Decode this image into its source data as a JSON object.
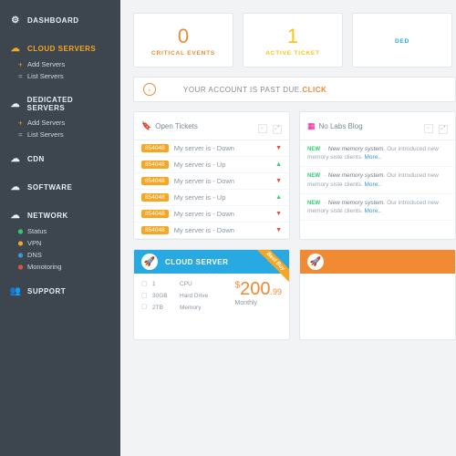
{
  "sidebar": {
    "items": [
      {
        "label": "DASHBOARD",
        "icon": "⚙"
      },
      {
        "label": "CLOUD SERVERS",
        "icon": "☁",
        "active": true,
        "subs": [
          {
            "label": "Add Servers",
            "type": "plus"
          },
          {
            "label": "List Servers",
            "type": "dash"
          }
        ]
      },
      {
        "label": "DEDICATED SERVERS",
        "icon": "☁",
        "subs": [
          {
            "label": "Add Servers",
            "type": "plus"
          },
          {
            "label": "List Servers",
            "type": "dash"
          }
        ]
      },
      {
        "label": "CDN",
        "icon": "☁"
      },
      {
        "label": "SOFTWARE",
        "icon": "☁"
      },
      {
        "label": "NETWORK",
        "icon": "☁",
        "subs": [
          {
            "label": "Status",
            "type": "dot",
            "color": "#2ecc71"
          },
          {
            "label": "VPN",
            "type": "dot",
            "color": "#f5a623"
          },
          {
            "label": "DNS",
            "type": "dot",
            "color": "#3498db"
          },
          {
            "label": "Monotoring",
            "type": "dot",
            "color": "#e74c3c"
          }
        ]
      },
      {
        "label": "SUPPORT",
        "icon": "👥"
      }
    ]
  },
  "stats": [
    {
      "value": "0",
      "label": "CRITICAL EVENTS",
      "color": "#f08a33"
    },
    {
      "value": "1",
      "label": "ACTIVE TICKET",
      "color": "#f5c518"
    },
    {
      "value": "",
      "label": "DED",
      "color": "#29a9e1"
    }
  ],
  "alert": {
    "text": "YOUR ACCOUNT IS PAST DUE. ",
    "action": "CLICK",
    "arrow": "›"
  },
  "tickets": {
    "title": "Open Tickets",
    "rows": [
      {
        "id": "854048",
        "text": "My server is - Down",
        "dir": "down"
      },
      {
        "id": "854048",
        "text": "My server is - Up",
        "dir": "up"
      },
      {
        "id": "854048",
        "text": "My server is - Down",
        "dir": "down"
      },
      {
        "id": "854048",
        "text": "My server is - Up",
        "dir": "up"
      },
      {
        "id": "854048",
        "text": "My server is - Down",
        "dir": "down"
      },
      {
        "id": "854048",
        "text": "My server is - Down",
        "dir": "down"
      }
    ]
  },
  "blog": {
    "title": "No Labs Blog",
    "rows": [
      {
        "tag": "NEW",
        "title": "New memory system.",
        "body": "Our introduced new memory siste clients.",
        "more": "More.."
      },
      {
        "tag": "NEW",
        "title": "New memory system.",
        "body": "Our introduced new memory siste clients.",
        "more": "More.."
      },
      {
        "tag": "NEW",
        "title": "New memory system.",
        "body": "Our introduced new memory siste clients.",
        "more": "More.."
      }
    ]
  },
  "product": {
    "name": "CLOUD SERVER",
    "ribbon": "Best Buy",
    "specs": [
      {
        "val": "1",
        "label": "CPU"
      },
      {
        "val": "30GB",
        "label": "Hard Drive"
      },
      {
        "val": "2TB",
        "label": "Memory"
      }
    ],
    "price": {
      "currency": "$",
      "whole": "200",
      "cents": ".99",
      "period": "Monthly"
    }
  }
}
